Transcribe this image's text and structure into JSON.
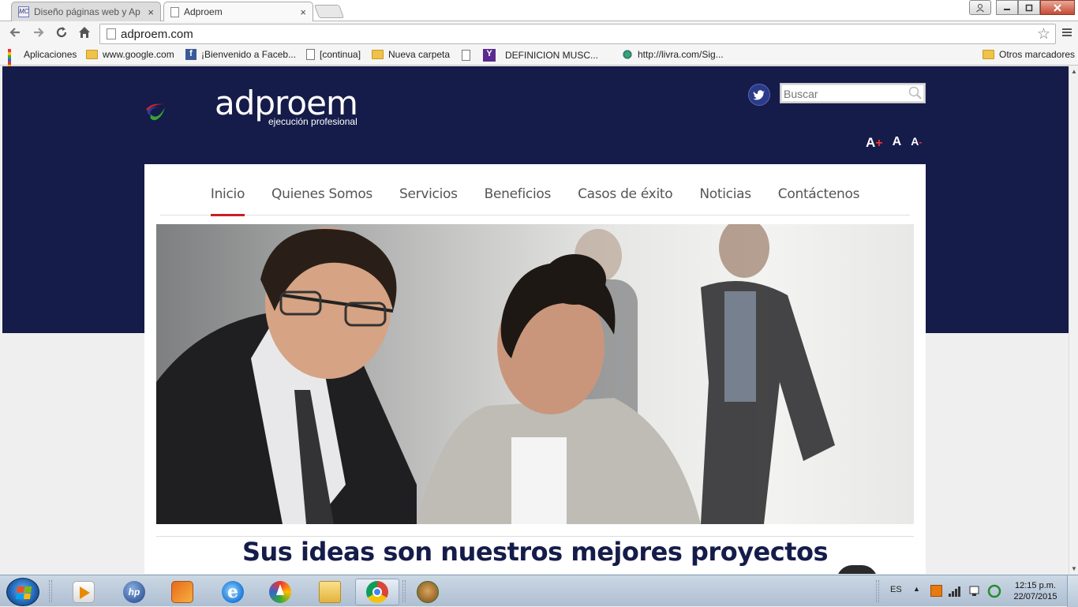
{
  "browser": {
    "tabs": [
      {
        "title": "Diseño páginas web y Ap",
        "active": false
      },
      {
        "title": "Adproem",
        "active": true
      }
    ],
    "tab_close_glyph": "×",
    "url": "adproem.com",
    "bookmarks": [
      {
        "label": "Aplicaciones",
        "icon": "apps-grid-icon"
      },
      {
        "label": "www.google.com",
        "icon": "folder-icon"
      },
      {
        "label": "¡Bienvenido a Faceb...",
        "icon": "facebook-icon"
      },
      {
        "label": "[continua]",
        "icon": "page-icon"
      },
      {
        "label": "Nueva carpeta",
        "icon": "folder-icon"
      },
      {
        "label": "DEFINICION MUSC...",
        "icon": "yahoo-icon"
      },
      {
        "label": "http://livra.com/Sig...",
        "icon": "livra-icon"
      },
      {
        "label": "Otros marcadores",
        "icon": "folder-icon"
      }
    ]
  },
  "site": {
    "logo_word": "adproem",
    "logo_tagline": "ejecución profesional",
    "search_placeholder": "Buscar",
    "font_controls": [
      "A",
      "A",
      "A"
    ],
    "font_control_marks": [
      "+",
      "",
      "-"
    ],
    "nav": [
      {
        "label": "Inicio",
        "active": true
      },
      {
        "label": "Quienes Somos",
        "active": false
      },
      {
        "label": "Servicios",
        "active": false
      },
      {
        "label": "Beneficios",
        "active": false
      },
      {
        "label": "Casos de éxito",
        "active": false
      },
      {
        "label": "Noticias",
        "active": false
      },
      {
        "label": "Contáctenos",
        "active": false
      }
    ],
    "tagline": "Sus ideas son nuestros mejores proyectos",
    "colors": {
      "header_navy": "#151c4a",
      "active_underline": "#c91f25",
      "logo_red": "#d9222a",
      "logo_green": "#3aa335",
      "logo_blue": "#2b3e9c"
    }
  },
  "taskbar": {
    "language": "ES",
    "time": "12:15 p.m.",
    "date": "22/07/2015",
    "apps": [
      "media-player-icon",
      "hp-icon",
      "file-manager-icon",
      "internet-explorer-icon",
      "update-icon",
      "explorer-folder-icon",
      "chrome-icon",
      "bonzi-icon"
    ]
  }
}
